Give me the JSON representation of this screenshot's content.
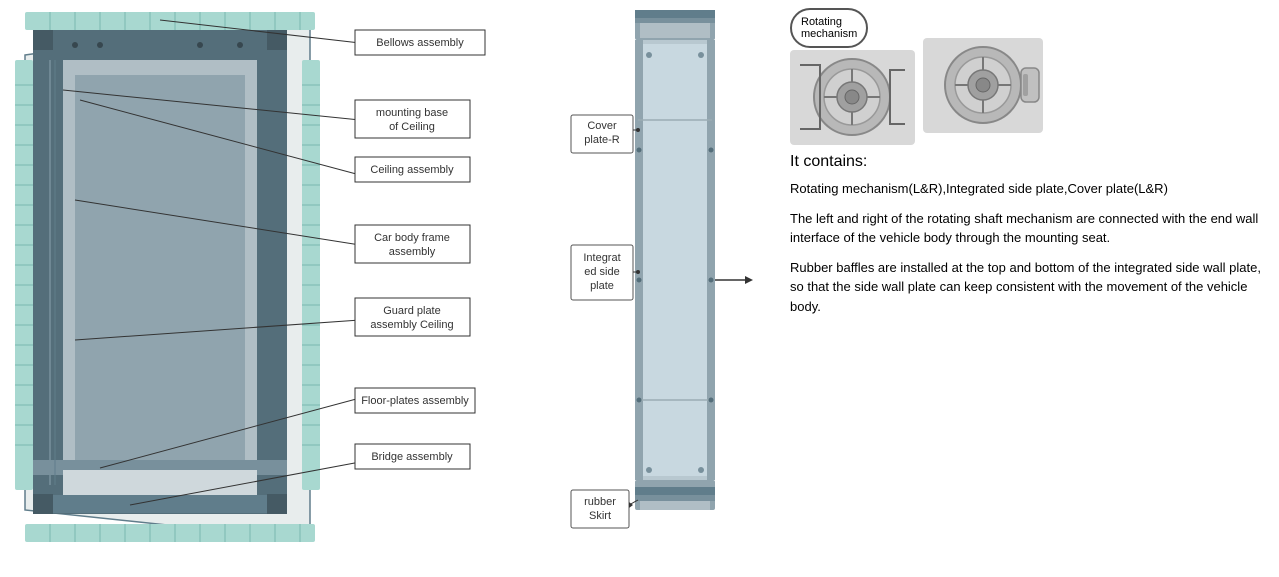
{
  "labels": {
    "bellows_assembly": "Bellows assembly",
    "mounting_base": "mounting base\nof Ceiling",
    "ceiling_assembly": "Ceiling assembly",
    "car_body_frame": "Car body frame\nassembly",
    "guard_plate": "Guard plate\nassembly Ceiling",
    "floor_plates": "Floor-plates assembly",
    "bridge_assembly": "Bridge assembly",
    "cover_plate_r": "Cover\nplate-R",
    "integrated_side_plate": "Integrat\ned side\nplate",
    "rubber_skirt": "rubber\nSkirt",
    "rotating_mechanism": "Rotating\nmechanism"
  },
  "description": {
    "title": "It contains:",
    "para1": "Rotating mechanism(L&R),Integrated side plate,Cover plate(L&R)",
    "para2": "The left and right of the rotating shaft mechanism are connected with the end wall interface of the vehicle body through the mounting seat.",
    "para3": "Rubber baffles are installed at the top and bottom of the integrated side  wall plate, so that the side wall plate can keep consistent with the movement of the vehicle body."
  },
  "colors": {
    "bg": "#ffffff",
    "box_border": "#333333",
    "line_color": "#333333",
    "panel_main": "#b0bec5",
    "panel_edge": "#78909c",
    "bellows_color": "#90c8c0",
    "frame_color": "#546e7a"
  }
}
